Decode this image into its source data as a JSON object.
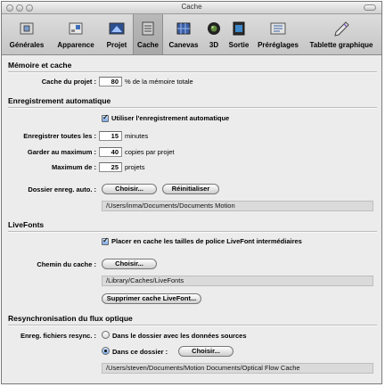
{
  "window": {
    "title": "Cache"
  },
  "toolbar": {
    "tabs": [
      {
        "label": "Générales",
        "icon": "general-icon"
      },
      {
        "label": "Apparence",
        "icon": "appearance-icon"
      },
      {
        "label": "Projet",
        "icon": "project-icon"
      },
      {
        "label": "Cache",
        "icon": "cache-icon",
        "selected": true
      },
      {
        "label": "Canevas",
        "icon": "canvas-icon"
      },
      {
        "label": "3D",
        "icon": "3d-icon"
      },
      {
        "label": "Sortie",
        "icon": "output-icon"
      },
      {
        "label": "Préréglages",
        "icon": "presets-icon"
      },
      {
        "label": "Tablette graphique",
        "icon": "tablet-icon"
      }
    ]
  },
  "memory": {
    "section_title": "Mémoire et cache",
    "project_cache_label": "Cache du projet :",
    "project_cache_value": "80",
    "project_cache_suffix": "% de la mémoire totale"
  },
  "autosave": {
    "section_title": "Enregistrement automatique",
    "use_autosave_label": "Utiliser l'enregistrement automatique",
    "use_autosave_checked": true,
    "save_every_label": "Enregistrer toutes les :",
    "save_every_value": "15",
    "save_every_unit": "minutes",
    "keep_max_label": "Garder au maximum :",
    "keep_max_value": "40",
    "keep_max_unit": "copies par projet",
    "maximum_label": "Maximum de :",
    "maximum_value": "25",
    "maximum_unit": "projets",
    "folder_label": "Dossier enreg. auto. :",
    "choose_button": "Choisir...",
    "reset_button": "Réinitialiser",
    "folder_path": "/Users/inma/Documents/Documents Motion"
  },
  "livefonts": {
    "section_title": "LiveFonts",
    "cache_sizes_label": "Placer en cache les tailles de police LiveFont intermédiaires",
    "cache_sizes_checked": true,
    "cache_path_label": "Chemin du cache :",
    "choose_button": "Choisir...",
    "cache_path": "/Library/Caches/LiveFonts",
    "delete_button": "Supprimer cache LiveFont..."
  },
  "optical_flow": {
    "section_title": "Resynchronisation du flux optique",
    "save_files_label": "Enreg. fichiers resync. :",
    "option_source": "Dans le dossier avec les données sources",
    "option_folder": "Dans ce dossier :",
    "selected_option": "folder",
    "choose_button": "Choisir...",
    "folder_path": "/Users/steven/Documents/Motion Documents/Optical Flow Cache"
  }
}
